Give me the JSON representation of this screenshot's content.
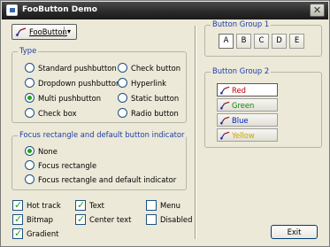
{
  "window": {
    "title": "FooButton Demo",
    "close_glyph": "✕"
  },
  "foobutton": {
    "label": "FooButton",
    "dropdown_glyph": "▾",
    "icon": "pointer-arrows-icon"
  },
  "type_group": {
    "legend": "Type",
    "options": [
      {
        "label": "Standard pushbutton",
        "selected": false
      },
      {
        "label": "Dropdown pushbutton",
        "selected": false
      },
      {
        "label": "Multi pushbutton",
        "selected": true
      },
      {
        "label": "Check box",
        "selected": false
      },
      {
        "label": "Check button",
        "selected": false
      },
      {
        "label": "Hyperlink",
        "selected": false
      },
      {
        "label": "Static button",
        "selected": false
      },
      {
        "label": "Radio button",
        "selected": false
      }
    ]
  },
  "focus_group": {
    "legend": "Focus rectangle and default button indicator",
    "options": [
      {
        "label": "None",
        "selected": true
      },
      {
        "label": "Focus rectangle",
        "selected": false
      },
      {
        "label": "Focus rectangle and default indicator",
        "selected": false
      }
    ]
  },
  "checkboxes": [
    {
      "label": "Hot track",
      "checked": true
    },
    {
      "label": "Bitmap",
      "checked": true
    },
    {
      "label": "Gradient",
      "checked": true
    },
    {
      "label": "Text",
      "checked": true
    },
    {
      "label": "Center text",
      "checked": true
    },
    {
      "label": "Menu",
      "checked": false
    },
    {
      "label": "Disabled",
      "checked": false
    }
  ],
  "check_mark": "✓",
  "button_group_1": {
    "legend": "Button Group 1",
    "buttons": [
      "A",
      "B",
      "C",
      "D",
      "E"
    ],
    "selected": "A"
  },
  "button_group_2": {
    "legend": "Button Group 2",
    "buttons": [
      {
        "label": "Red",
        "color": "#c00000",
        "selected": true
      },
      {
        "label": "Green",
        "color": "#0a8a0a",
        "selected": false
      },
      {
        "label": "Blue",
        "color": "#0020c0",
        "selected": false
      },
      {
        "label": "Yellow",
        "color": "#c9a800",
        "selected": false
      }
    ]
  },
  "exit_label": "Exit",
  "colors": {
    "legend_text": "#1d3ea7",
    "title_bar": "#2b2b2b",
    "radio_dot": "#21a121",
    "check_mark": "#21a121"
  }
}
